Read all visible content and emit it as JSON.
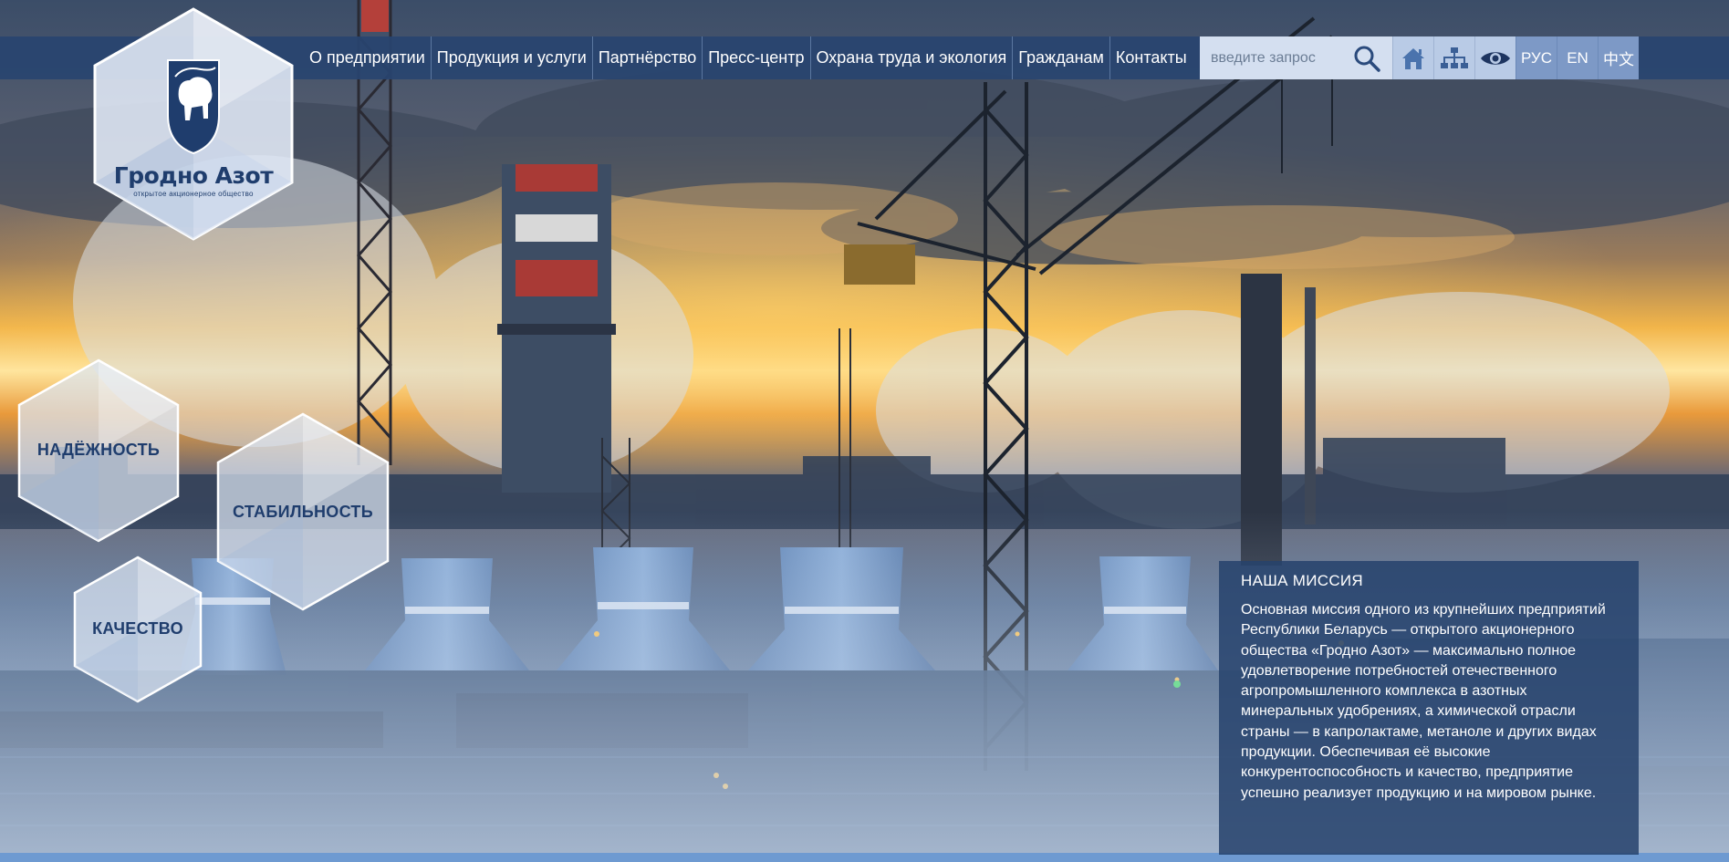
{
  "logo": {
    "title": "Гродно Азот",
    "subtitle": "открытое акционерное общество"
  },
  "nav": {
    "items": [
      "О предприятии",
      "Продукция и услуги",
      "Партнёрство",
      "Пресс-центр",
      "Охрана труда и экология",
      "Гражданам",
      "Контакты"
    ]
  },
  "search": {
    "placeholder": "введите запрос",
    "value": ""
  },
  "toolbar": {
    "icons": [
      "home-icon",
      "sitemap-icon",
      "eye-icon"
    ],
    "languages": [
      "РУС",
      "EN",
      "中文"
    ]
  },
  "values": {
    "reliability": "НАДЁЖНОСТЬ",
    "stability": "СТАБИЛЬНОСТЬ",
    "quality": "КАЧЕСТВО"
  },
  "mission": {
    "heading": "НАША МИССИЯ",
    "text": "Основная миссия одного из крупнейших предприятий Республики Беларусь — открытого акционерного общества «Гродно Азот» — максимально полное удовлетворение потребностей отечественного агропромышленного комплекса в азотных минеральных удобрениях, а химической отрасли страны — в капролактаме, метаноле и других видах продукции. Обеспечивая её высокие конкурентоспособность и качество, предприятие успешно реализует продукцию и на мировом рынке."
  },
  "colors": {
    "brand_navy": "#1f3d6d",
    "nav_bg": "#284470",
    "search_bg": "#d4dff0",
    "lang_bg": "#7d99c6",
    "sky_glow": "#ffd26b"
  }
}
